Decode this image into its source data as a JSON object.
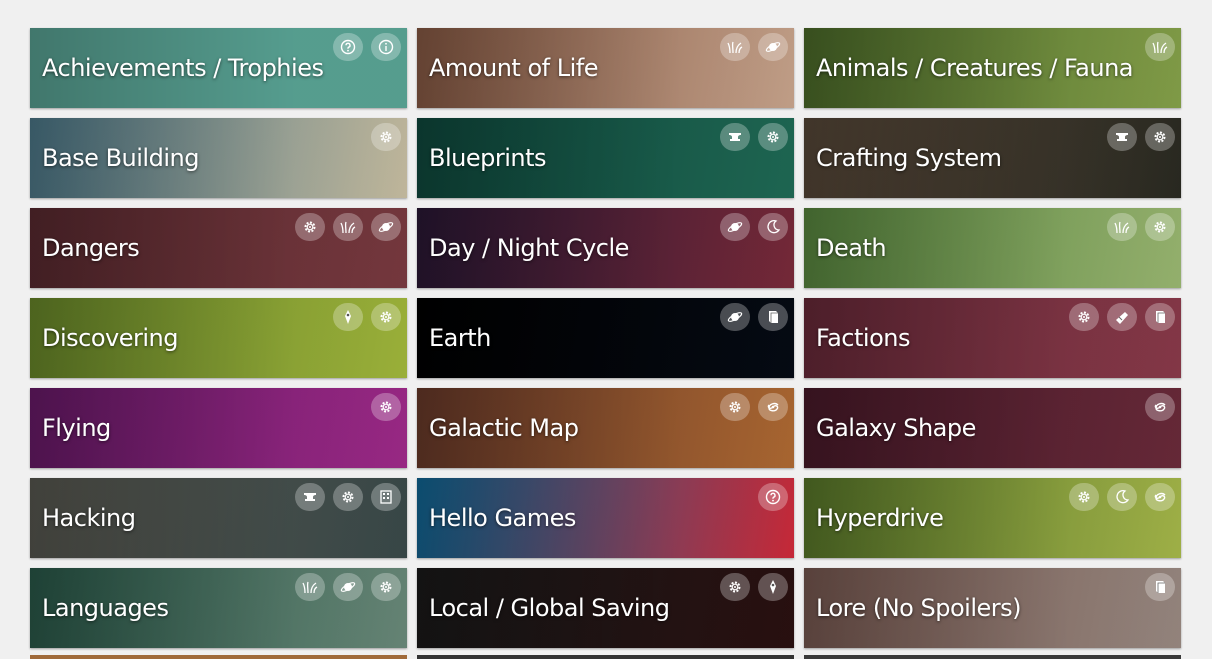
{
  "cards": [
    {
      "title": "Achievements / Trophies",
      "bg": "#5aa596",
      "bg2": "#5aa596",
      "icons": [
        "question-icon",
        "info-icon"
      ]
    },
    {
      "title": "Amount of Life",
      "bg": "#8a5b45",
      "bg2": "#c9a58d",
      "icons": [
        "grass-icon",
        "planet-icon"
      ]
    },
    {
      "title": "Animals / Creatures / Fauna",
      "bg": "#4d6d2a",
      "bg2": "#86a24a",
      "icons": [
        "grass-icon"
      ]
    },
    {
      "title": "Base Building",
      "bg": "#4d7a8c",
      "bg2": "#c9bfa2",
      "icons": [
        "gear-icon"
      ]
    },
    {
      "title": "Blueprints",
      "bg": "#0f4a3e",
      "bg2": "#1f6a55",
      "icons": [
        "anvil-icon",
        "gear-icon"
      ]
    },
    {
      "title": "Crafting System",
      "bg": "#5a4a3a",
      "bg2": "#2a2a22",
      "icons": [
        "anvil-icon",
        "gear-icon"
      ]
    },
    {
      "title": "Dangers",
      "bg": "#5a2a30",
      "bg2": "#7a3a40",
      "icons": [
        "gear-icon",
        "grass-icon",
        "planet-icon"
      ]
    },
    {
      "title": "Day / Night Cycle",
      "bg": "#2a1836",
      "bg2": "#7a2a3a",
      "icons": [
        "planet-icon",
        "moon-icon"
      ]
    },
    {
      "title": "Death",
      "bg": "#5a8a40",
      "bg2": "#9bb872",
      "icons": [
        "grass-icon",
        "gear-icon"
      ]
    },
    {
      "title": "Discovering",
      "bg": "#6a8a2a",
      "bg2": "#a2b83c",
      "icons": [
        "location-icon",
        "gear-icon"
      ]
    },
    {
      "title": "Earth",
      "bg": "#000000",
      "bg2": "#050a14",
      "icons": [
        "planet-icon",
        "book-icon"
      ]
    },
    {
      "title": "Factions",
      "bg": "#6a2a3a",
      "bg2": "#8a3a4a",
      "icons": [
        "gear-icon",
        "ship-icon",
        "book-icon"
      ]
    },
    {
      "title": "Flying",
      "bg": "#6a1a6a",
      "bg2": "#a02a8a",
      "icons": [
        "gear-icon"
      ]
    },
    {
      "title": "Galactic Map",
      "bg": "#6a3a2a",
      "bg2": "#b06a32",
      "icons": [
        "gear-icon",
        "galaxy-icon"
      ]
    },
    {
      "title": "Galaxy Shape",
      "bg": "#4a1a2a",
      "bg2": "#6a2a3a",
      "icons": [
        "galaxy-icon"
      ]
    },
    {
      "title": "Hacking",
      "bg": "#5a5a52",
      "bg2": "#3a4a4a",
      "icons": [
        "anvil-icon",
        "gear-icon",
        "building-icon"
      ]
    },
    {
      "title": "Hello Games",
      "bg": "#0f6a9a",
      "bg2": "#d02a3a",
      "icons": [
        "question-icon"
      ]
    },
    {
      "title": "Hyperdrive",
      "bg": "#5a7a2a",
      "bg2": "#a6b84a",
      "icons": [
        "gear-icon",
        "moon-icon",
        "galaxy-icon"
      ]
    },
    {
      "title": "Languages",
      "bg": "#2a5a4a",
      "bg2": "#6a8a7a",
      "icons": [
        "grass-icon",
        "planet-icon",
        "gear-icon"
      ]
    },
    {
      "title": "Local / Global Saving",
      "bg": "#1a1a1a",
      "bg2": "#2a1010",
      "icons": [
        "gear-icon",
        "location-icon"
      ]
    },
    {
      "title": "Lore (No Spoilers)",
      "bg": "#7a5a52",
      "bg2": "#9a8a82",
      "icons": [
        "book-icon"
      ]
    }
  ],
  "colors": {
    "page_bg": "#f0f0f0"
  }
}
